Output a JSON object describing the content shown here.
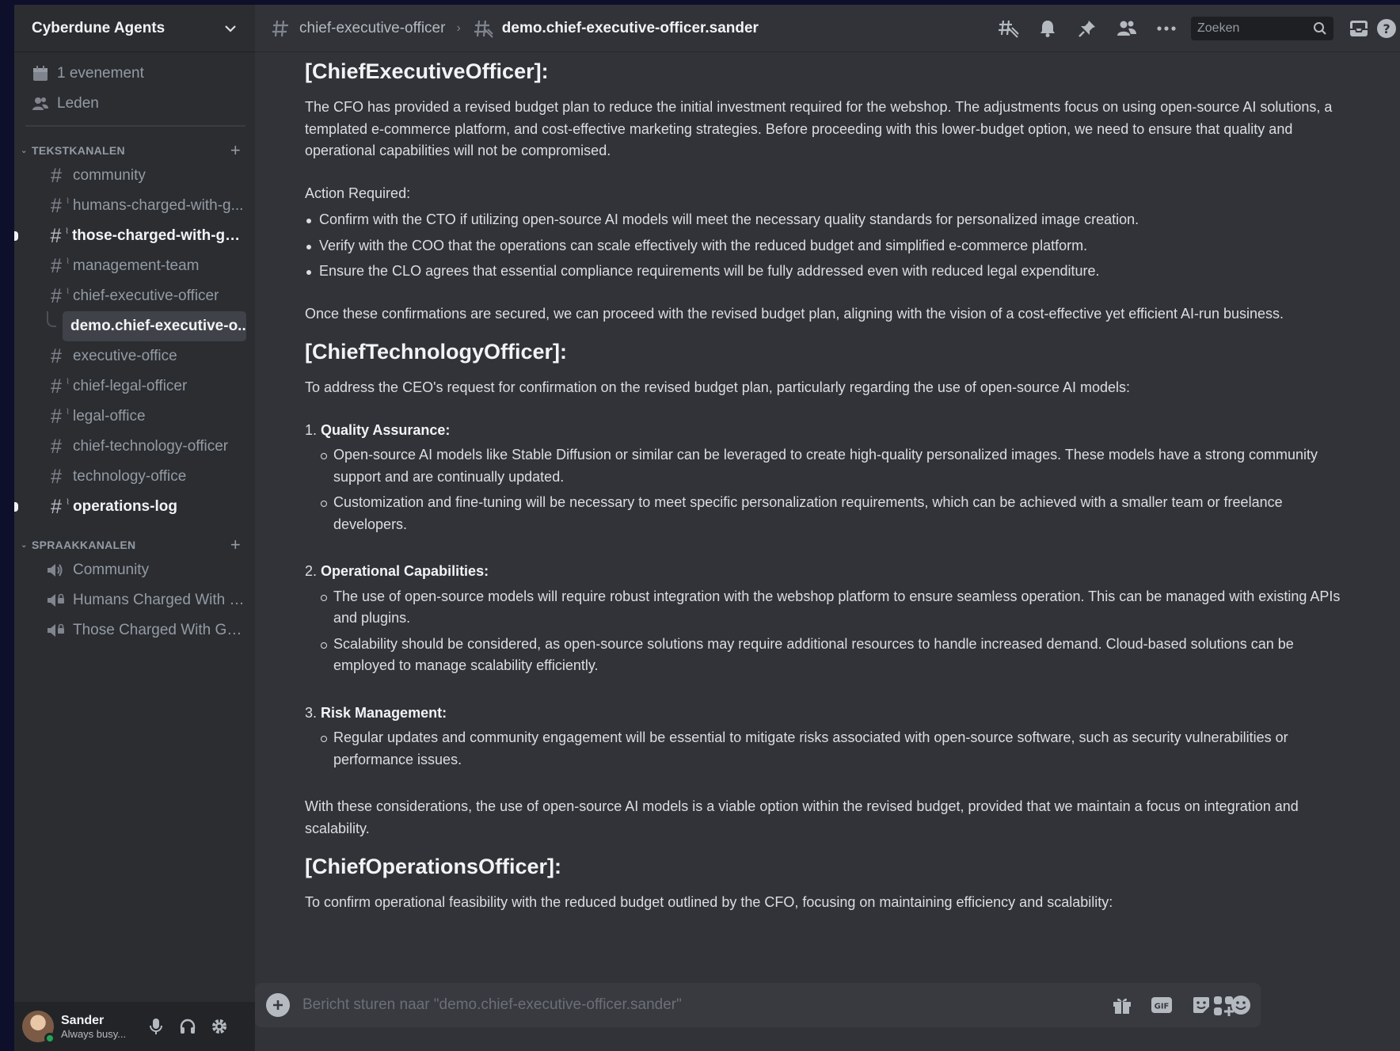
{
  "server": {
    "name": "Cyberdune Agents"
  },
  "sidebar": {
    "top_items": [
      {
        "label": "1 evenement",
        "icon": "calendar-icon"
      },
      {
        "label": "Leden",
        "icon": "members-icon"
      }
    ],
    "text_category": "TEKSTKANALEN",
    "text_channels": [
      {
        "label": "community"
      },
      {
        "label": "humans-charged-with-g..."
      },
      {
        "label": "those-charged-with-gov..."
      },
      {
        "label": "management-team"
      },
      {
        "label": "chief-executive-officer"
      },
      {
        "label": "demo.chief-executive-o..."
      },
      {
        "label": "executive-office"
      },
      {
        "label": "chief-legal-officer"
      },
      {
        "label": "legal-office"
      },
      {
        "label": "chief-technology-officer"
      },
      {
        "label": "technology-office"
      },
      {
        "label": "operations-log"
      }
    ],
    "voice_category": "SPRAAKKANALEN",
    "voice_channels": [
      {
        "label": "Community"
      },
      {
        "label": "Humans Charged With G..."
      },
      {
        "label": "Those Charged With Gov..."
      }
    ]
  },
  "user": {
    "name": "Sander",
    "status": "Always busy..."
  },
  "topbar": {
    "parent_channel": "chief-executive-officer",
    "thread_title": "demo.chief-executive-officer.sander",
    "search_placeholder": "Zoeken"
  },
  "messages": {
    "ceo": {
      "heading": "[ChiefExecutiveOfficer]:",
      "p1": "The CFO has provided a revised budget plan to reduce the initial investment required for the webshop. The adjustments focus on using open-source AI solutions, a templated e-commerce platform, and cost-effective marketing strategies. Before proceeding with this lower-budget option, we need to ensure that quality and operational capabilities will not be compromised.",
      "action_label": "Action Required:",
      "bullets": [
        "Confirm with the CTO if utilizing open-source AI models will meet the necessary quality standards for personalized image creation.",
        "Verify with the COO that the operations can scale effectively with the reduced budget and simplified e-commerce platform.",
        "Ensure the CLO agrees that essential compliance requirements will be fully addressed even with reduced legal expenditure."
      ],
      "p2": "Once these confirmations are secured, we can proceed with the revised budget plan, aligning with the vision of a cost-effective yet efficient AI-run business."
    },
    "cto": {
      "heading": "[ChiefTechnologyOfficer]:",
      "intro": "To address the CEO's request for confirmation on the revised budget plan, particularly regarding the use of open-source AI models:",
      "sections": [
        {
          "num": "1.",
          "title": "Quality Assurance:",
          "items": [
            "Open-source AI models like Stable Diffusion or similar can be leveraged to create high-quality personalized images. These models have a strong community support and are continually updated.",
            "Customization and fine-tuning will be necessary to meet specific personalization requirements, which can be achieved with a smaller team or freelance developers."
          ]
        },
        {
          "num": "2.",
          "title": "Operational Capabilities:",
          "items": [
            "The use of open-source models will require robust integration with the webshop platform to ensure seamless operation. This can be managed with existing APIs and plugins.",
            "Scalability should be considered, as open-source solutions may require additional resources to handle increased demand. Cloud-based solutions can be employed to manage scalability efficiently."
          ]
        },
        {
          "num": "3.",
          "title": "Risk Management:",
          "items": [
            "Regular updates and community engagement will be essential to mitigate risks associated with open-source software, such as security vulnerabilities or performance issues."
          ]
        }
      ],
      "conclusion": "With these considerations, the use of open-source AI models is a viable option within the revised budget, provided that we maintain a focus on integration and scalability."
    },
    "coo": {
      "heading": "[ChiefOperationsOfficer]:",
      "p1": "To confirm operational feasibility with the reduced budget outlined by the CFO, focusing on maintaining efficiency and scalability:"
    }
  },
  "composer": {
    "placeholder": "Bericht sturen naar \"demo.chief-executive-officer.sander\"",
    "gif_label": "GIF"
  },
  "colors": {
    "background": "#313338",
    "sidebar": "#2b2d31",
    "selected": "#404249",
    "online": "#23a55a"
  }
}
